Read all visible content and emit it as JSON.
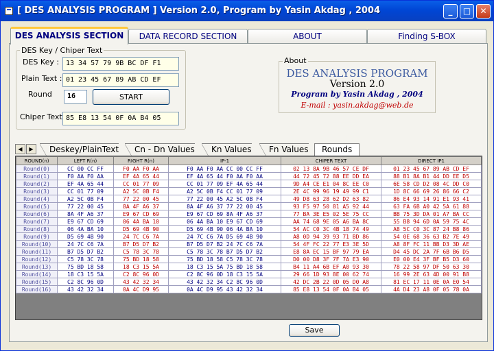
{
  "window": {
    "title": "[ DES ANALYSIS PROGRAM ]  Version 2.0,  Program by Yasin Akdag , 2004",
    "controls": {
      "minimize": "_",
      "maximize": "□",
      "close": "✕"
    }
  },
  "tabs": [
    {
      "label": "DES ANALYSIS SECTION",
      "active": true
    },
    {
      "label": "DATA RECORD SECTION",
      "active": false
    },
    {
      "label": "ABOUT",
      "active": false
    },
    {
      "label": "Finding S-BOX",
      "active": false
    }
  ],
  "key_group": {
    "title": "DES Key / Chiper Text",
    "des_key_label": "DES Key :",
    "des_key_value": "13 34 57 79 9B BC DF F1",
    "plain_text_label": "Plain Text :",
    "plain_text_value": "01 23 45 67 89 AB CD EF",
    "round_label": "Round",
    "round_value": "16",
    "start_label": "START",
    "chiper_text_label": "Chiper Text",
    "chiper_text_value": "85 E8 13 54 0F 0A B4 05"
  },
  "about": {
    "group_title": "About",
    "title": "DES ANALYSIS PROGRAM",
    "version": "Version 2.0",
    "by": "Program by Yasin Akdag , 2004",
    "email": "E-mail : yasin.akdag@web.de"
  },
  "subtabs": {
    "arrows": [
      "◀",
      "▶"
    ],
    "items": [
      {
        "label": "Deskey/PlainText",
        "active": false
      },
      {
        "label": "Cn - Dn Values",
        "active": false
      },
      {
        "label": "Kn Values",
        "active": false
      },
      {
        "label": "Fn Values",
        "active": false
      },
      {
        "label": "Rounds",
        "active": true
      }
    ]
  },
  "grid": {
    "columns": [
      "ROUND(n)",
      "LEFT R(n)",
      "RIGHT R(n)",
      "IP-1",
      "CHIPER TEXT",
      "DIRECT IP1"
    ],
    "rows": [
      [
        "Round(0)",
        "CC 00 CC FF",
        "F0 AA F0 AA",
        "F0 AA F0 AA CC 00 CC FF",
        "02 13 8A 9B 46 57 CE DF",
        "01 23 45 67 89 AB CD EF"
      ],
      [
        "Round(1)",
        "F0 AA F0 AA",
        "EF 4A 65 44",
        "EF 4A 65 44 F0 AA F0 AA",
        "44 72 45 72 88 EE DD EA",
        "88 B1 8A B1 44 DD EE D5"
      ],
      [
        "Round(2)",
        "EF 4A 65 44",
        "CC 01 77 09",
        "CC 01 77 09 EF 4A 65 44",
        "9D A4 CE E1 04 8C EE C0",
        "6E 58 CD D2 08 4C DD C0"
      ],
      [
        "Round(3)",
        "CC 01 77 09",
        "A2 5C 0B F4",
        "A2 5C 0B F4 CC 01 77 09",
        "2E 4C 99 96 19 49 99 C1",
        "1D 8C 66 69 26 86 66 C2"
      ],
      [
        "Round(4)",
        "A2 5C 0B F4",
        "77 22 00 45",
        "77 22 00 45 A2 5C 0B F4",
        "49 D8 63 28 62 D2 63 82",
        "86 E4 93 14 91 E1 93 41"
      ],
      [
        "Round(5)",
        "77 22 00 45",
        "8A 4F A6 37",
        "8A 4F A6 37 77 22 00 45",
        "93 F5 97 50 81 A5 92 44",
        "63 FA 6B A0 42 5A 61 88"
      ],
      [
        "Round(6)",
        "8A 4F A6 37",
        "E9 67 CD 69",
        "E9 67 CD 69 8A 4F A6 37",
        "77 BA 3E E5 02 5E 75 CC",
        "BB 75 3D DA 01 A7 BA CC"
      ],
      [
        "Round(7)",
        "E9 67 CD 69",
        "06 4A BA 10",
        "06 4A BA 10 E9 67 CD 69",
        "AA 74 68 9E 05 A6 BA 8C",
        "55 B8 94 6D 0A 59 75 4C"
      ],
      [
        "Round(8)",
        "06 4A BA 10",
        "D5 69 4B 90",
        "D5 69 4B 90 06 4A BA 10",
        "54 AC C0 3C 4B 18 74 49",
        "A8 5C C0 3C 87 24 B8 86"
      ],
      [
        "Round(9)",
        "D5 69 4B 90",
        "24 7C C6 7A",
        "24 7C C6 7A D5 69 4B 90",
        "A8 0D 94 39 93 71 BD 86",
        "54 0E 68 36 63 B2 7E 49"
      ],
      [
        "Round(10)",
        "24 7C C6 7A",
        "B7 D5 D7 B2",
        "B7 D5 D7 B2 24 7C C6 7A",
        "54 4F FC 22 77 E3 3E 5D",
        "A8 8F FC 11 BB D3 3D AE"
      ],
      [
        "Round(11)",
        "B7 D5 D7 B2",
        "C5 78 3C 78",
        "C5 78 3C 78 B7 D5 D7 B2",
        "E8 8A EC 15 BF 97 79 EA",
        "D4 45 DC 2A 7F 6B B6 D5"
      ],
      [
        "Round(12)",
        "C5 78 3C 78",
        "75 BD 18 58",
        "75 BD 18 58 C5 78 3C 78",
        "D0 00 D8 3F 7F 7A E3 90",
        "E0 00 E4 3F BF B5 D3 60"
      ],
      [
        "Round(13)",
        "75 BD 18 58",
        "18 C3 15 5A",
        "18 C3 15 5A 75 BD 18 58",
        "B4 11 A4 6B EF A0 93 30",
        "78 22 58 97 DF 50 63 30"
      ],
      [
        "Round(14)",
        "18 C3 15 5A",
        "C2 8C 96 0D",
        "C2 8C 96 0D 18 C3 15 5A",
        "29 66 1D 93 8E 00 62 74",
        "16 99 2E 63 4D 00 91 B8"
      ],
      [
        "Round(15)",
        "C2 8C 96 0D",
        "43 42 32 34",
        "43 42 32 34 C2 8C 96 0D",
        "42 DC 2B 22 0D 05 D0 A8",
        "81 EC 17 11 0E 0A E0 54"
      ],
      [
        "Round(16)",
        "43 42 32 34",
        "0A 4C D9 95",
        "0A 4C D9 95 43 42 32 34",
        "85 E8 13 54 0F 0A B4 05",
        "4A D4 23 A8 0F 05 78 0A"
      ]
    ]
  },
  "save_label": "Save"
}
